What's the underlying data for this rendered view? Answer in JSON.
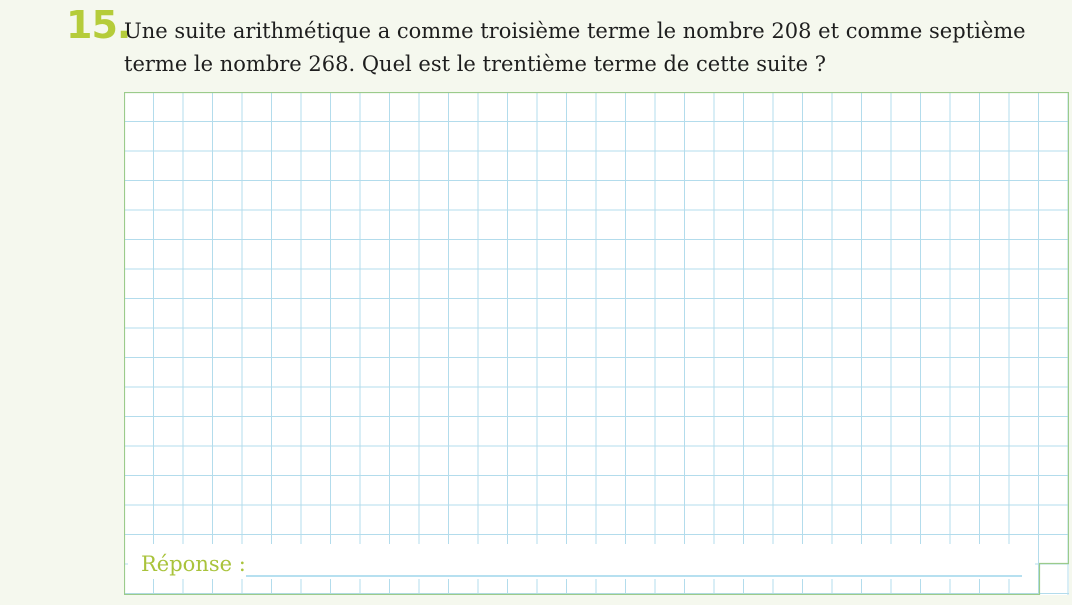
{
  "exercise": {
    "number": "15.",
    "question": "Une suite arithmétique a comme troisième terme le nombre 208 et comme septième terme le nombre 268. Quel est le trentième terme de cette suite ?"
  },
  "answer": {
    "label": "Réponse :"
  },
  "colors": {
    "accent": "#b5cc3a",
    "grid": "#b3dcec",
    "frame": "#9bcb8b",
    "answer_line": "#9ed6ec",
    "background": "#f5f8ee"
  }
}
